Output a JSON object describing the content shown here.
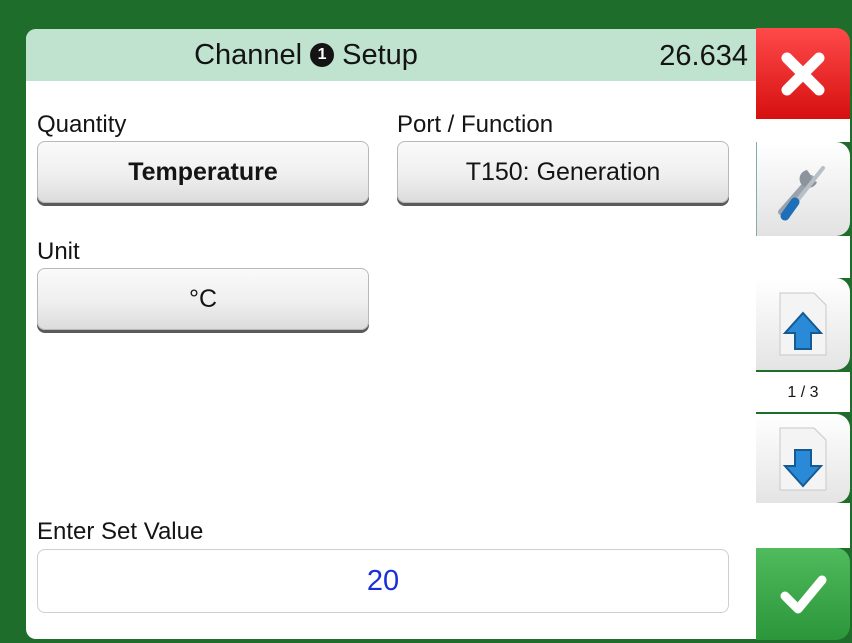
{
  "header": {
    "title_prefix": "Channel",
    "channel_number": "1",
    "title_suffix": "Setup",
    "reading": "26.634"
  },
  "quantity": {
    "label": "Quantity",
    "value": "Temperature"
  },
  "port": {
    "label": "Port / Function",
    "value": "T150: Generation"
  },
  "unit": {
    "label": "Unit",
    "value": "°C"
  },
  "setvalue": {
    "label": "Enter Set Value",
    "value": "20"
  },
  "sidebar": {
    "close_icon": "close-icon",
    "tools_icon": "tools-icon",
    "page_up_icon": "page-up-icon",
    "page_down_icon": "page-down-icon",
    "accept_icon": "checkmark-icon",
    "page_indicator": "1 / 3"
  },
  "colors": {
    "bezel": "#1f6d2b",
    "titlebar": "#bfe3cf",
    "close": "#e21b1b",
    "accept": "#3aa847",
    "value_text": "#1a2fd6"
  }
}
